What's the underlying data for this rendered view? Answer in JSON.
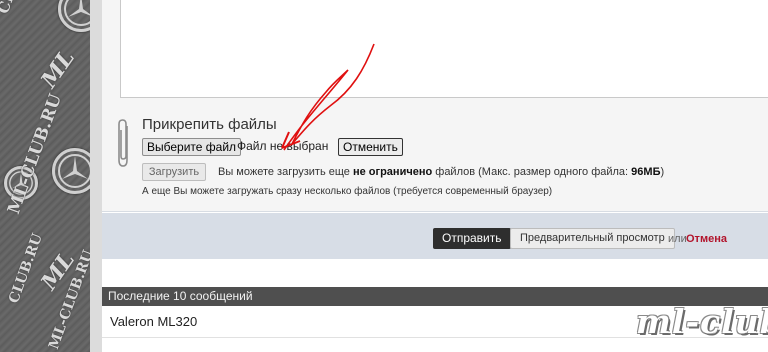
{
  "sidebar": {
    "watermark_site": "ML-CLUB.RU",
    "watermark_site_short": "CLUB.RU",
    "watermark_short": "ML"
  },
  "attachments": {
    "title": "Прикрепить файлы",
    "choose_file_label": "Выберите файл",
    "file_status": "Файл не выбран",
    "cancel_label": "Отменить",
    "upload_label": "Загрузить",
    "upload_info_prefix": "Вы можете загрузить еще",
    "upload_info_unlimited": "не ограничено",
    "upload_info_middle": "файлов (Макс. размер одного файла:",
    "upload_info_size": "96МБ",
    "upload_info_suffix": ")",
    "multi_note": "А еще Вы можете загружать сразу несколько файлов (требуется современный браузер)"
  },
  "actions": {
    "submit_label": "Отправить",
    "preview_label": "Предварительный просмотр",
    "or_text": "или",
    "cancel_link": "Отмена"
  },
  "recent": {
    "header": "Последние 10 сообщений",
    "rows": [
      "Valeron ML320"
    ]
  },
  "watermark": "ml-club.ru",
  "colors": {
    "accent_red": "#b2142c",
    "dark_button": "#2e2e2e",
    "bar_blue_gray": "#d7dde6"
  }
}
